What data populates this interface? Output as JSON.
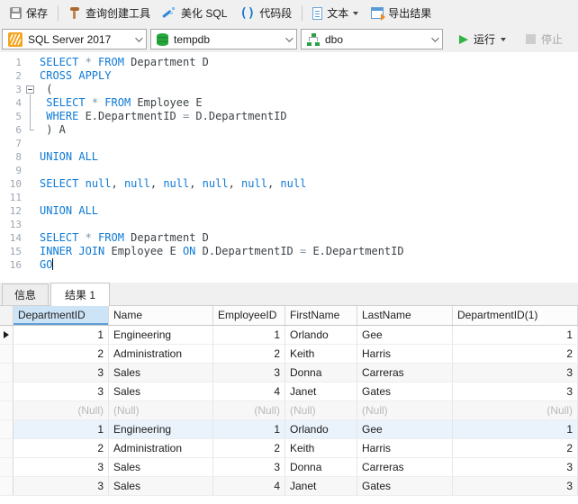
{
  "toolbar": {
    "save": "保存",
    "query_builder": "查询创建工具",
    "beautify": "美化 SQL",
    "snippet_parens": "()",
    "snippet": "代码段",
    "text": "文本",
    "export": "导出结果"
  },
  "connection_bar": {
    "server": "SQL Server 2017",
    "database": "tempdb",
    "schema": "dbo",
    "run": "运行",
    "stop": "停止"
  },
  "colors": {
    "keyword_blue": "#0e7ad6",
    "accent_blue": "#5b9bd5",
    "run_green": "#2fb344",
    "selected_header_blue": "#cde4f7",
    "server_orange": "#f6a41d",
    "db_green": "#27a73e",
    "null_text_gray": "#b9b9b9"
  },
  "editor": {
    "lines": [
      {
        "n": 1,
        "fold": "",
        "tokens": [
          [
            "k",
            "SELECT"
          ],
          [
            "g",
            " * "
          ],
          [
            "k",
            "FROM"
          ],
          [
            "p",
            " Department D"
          ]
        ]
      },
      {
        "n": 2,
        "fold": "",
        "tokens": [
          [
            "k",
            "CROSS APPLY"
          ]
        ]
      },
      {
        "n": 3,
        "fold": "start",
        "tokens": [
          [
            "p",
            " ("
          ]
        ]
      },
      {
        "n": 4,
        "fold": "mid",
        "tokens": [
          [
            "p",
            " "
          ],
          [
            "k",
            "SELECT"
          ],
          [
            "g",
            " * "
          ],
          [
            "k",
            "FROM"
          ],
          [
            "p",
            " Employee E"
          ]
        ]
      },
      {
        "n": 5,
        "fold": "mid",
        "tokens": [
          [
            "p",
            " "
          ],
          [
            "k",
            "WHERE"
          ],
          [
            "p",
            " E.DepartmentID "
          ],
          [
            "g",
            "="
          ],
          [
            "p",
            " D.DepartmentID"
          ]
        ]
      },
      {
        "n": 6,
        "fold": "end",
        "tokens": [
          [
            "p",
            " ) A"
          ]
        ]
      },
      {
        "n": 7,
        "fold": "",
        "tokens": []
      },
      {
        "n": 8,
        "fold": "",
        "tokens": [
          [
            "k",
            "UNION ALL"
          ]
        ]
      },
      {
        "n": 9,
        "fold": "",
        "tokens": []
      },
      {
        "n": 10,
        "fold": "",
        "tokens": [
          [
            "k",
            "SELECT"
          ],
          [
            "p",
            " "
          ],
          [
            "k",
            "null"
          ],
          [
            "p",
            ", "
          ],
          [
            "k",
            "null"
          ],
          [
            "p",
            ", "
          ],
          [
            "k",
            "null"
          ],
          [
            "p",
            ", "
          ],
          [
            "k",
            "null"
          ],
          [
            "p",
            ", "
          ],
          [
            "k",
            "null"
          ],
          [
            "p",
            ", "
          ],
          [
            "k",
            "null"
          ]
        ]
      },
      {
        "n": 11,
        "fold": "",
        "tokens": []
      },
      {
        "n": 12,
        "fold": "",
        "tokens": [
          [
            "k",
            "UNION ALL"
          ]
        ]
      },
      {
        "n": 13,
        "fold": "",
        "tokens": []
      },
      {
        "n": 14,
        "fold": "",
        "tokens": [
          [
            "k",
            "SELECT"
          ],
          [
            "g",
            " * "
          ],
          [
            "k",
            "FROM"
          ],
          [
            "p",
            " Department D"
          ]
        ]
      },
      {
        "n": 15,
        "fold": "",
        "tokens": [
          [
            "k",
            "INNER JOIN"
          ],
          [
            "p",
            " Employee E "
          ],
          [
            "k",
            "ON"
          ],
          [
            "p",
            " D.DepartmentID "
          ],
          [
            "g",
            "="
          ],
          [
            "p",
            " E.DepartmentID"
          ]
        ]
      },
      {
        "n": 16,
        "fold": "",
        "tokens": [
          [
            "k",
            "GO"
          ]
        ],
        "caret": true
      }
    ]
  },
  "tabs": [
    {
      "label": "信息",
      "active": false
    },
    {
      "label": "结果 1",
      "active": true
    }
  ],
  "results": {
    "columns": [
      {
        "label": "DepartmentID",
        "align": "right",
        "selected": true
      },
      {
        "label": "Name",
        "align": "left",
        "selected": false
      },
      {
        "label": "EmployeeID",
        "align": "right",
        "selected": false
      },
      {
        "label": "FirstName",
        "align": "left",
        "selected": false
      },
      {
        "label": "LastName",
        "align": "left",
        "selected": false
      },
      {
        "label": "DepartmentID(1)",
        "align": "right",
        "selected": false
      }
    ],
    "rows": [
      {
        "cells": [
          "1",
          "Engineering",
          "1",
          "Orlando",
          "Gee",
          "1"
        ],
        "bg": "white",
        "current": true,
        "null_row": false
      },
      {
        "cells": [
          "2",
          "Administration",
          "2",
          "Keith",
          "Harris",
          "2"
        ],
        "bg": "white",
        "current": false,
        "null_row": false
      },
      {
        "cells": [
          "3",
          "Sales",
          "3",
          "Donna",
          "Carreras",
          "3"
        ],
        "bg": "gray",
        "current": false,
        "null_row": false
      },
      {
        "cells": [
          "3",
          "Sales",
          "4",
          "Janet",
          "Gates",
          "3"
        ],
        "bg": "white",
        "current": false,
        "null_row": false
      },
      {
        "cells": [
          "(Null)",
          "(Null)",
          "(Null)",
          "(Null)",
          "(Null)",
          "(Null)"
        ],
        "bg": "gray",
        "current": false,
        "null_row": true
      },
      {
        "cells": [
          "1",
          "Engineering",
          "1",
          "Orlando",
          "Gee",
          "1"
        ],
        "bg": "blue",
        "current": false,
        "null_row": false
      },
      {
        "cells": [
          "2",
          "Administration",
          "2",
          "Keith",
          "Harris",
          "2"
        ],
        "bg": "white",
        "current": false,
        "null_row": false
      },
      {
        "cells": [
          "3",
          "Sales",
          "3",
          "Donna",
          "Carreras",
          "3"
        ],
        "bg": "white",
        "current": false,
        "null_row": false
      },
      {
        "cells": [
          "3",
          "Sales",
          "4",
          "Janet",
          "Gates",
          "3"
        ],
        "bg": "gray",
        "current": false,
        "null_row": false
      }
    ]
  }
}
